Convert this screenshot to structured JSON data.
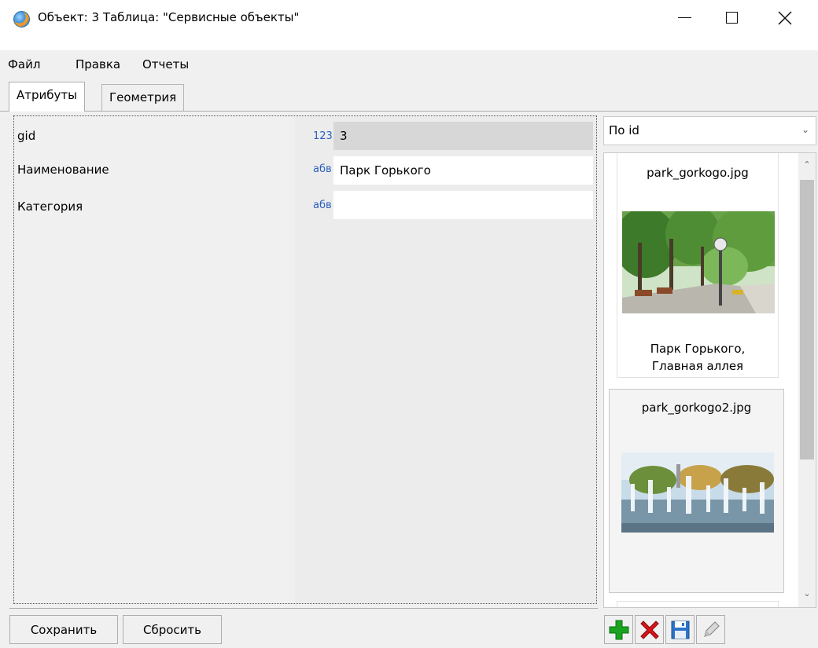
{
  "window": {
    "title": "Объект: 3 Таблица: \"Сервисные объекты\""
  },
  "menu": {
    "items": [
      "Файл",
      "Правка",
      "Отчеты"
    ]
  },
  "tabs": [
    {
      "label": "Атрибуты",
      "active": true
    },
    {
      "label": "Геометрия",
      "active": false
    }
  ],
  "attributes": [
    {
      "name": "gid",
      "type": "123",
      "value": "3",
      "readonly": true
    },
    {
      "name": "Наименование",
      "type": "абв",
      "value": "Парк Горького",
      "readonly": false
    },
    {
      "name": "Категория",
      "type": "абв",
      "value": "",
      "readonly": false
    }
  ],
  "sort": {
    "selected": "По id"
  },
  "gallery": {
    "items": [
      {
        "filename": "park_gorkogo.jpg",
        "caption_line1": "Парк Горького,",
        "caption_line2": "Главная аллея"
      },
      {
        "filename": "park_gorkogo2.jpg"
      }
    ]
  },
  "buttons": {
    "save": "Сохранить",
    "reset": "Сбросить"
  },
  "toolbar_icons": [
    "add-icon",
    "delete-icon",
    "save-icon",
    "edit-icon"
  ],
  "colors": {
    "type_badge": "#2b5fc0",
    "add_green": "#1aa320",
    "delete_red": "#d7141a",
    "save_blue": "#2c74c9"
  }
}
